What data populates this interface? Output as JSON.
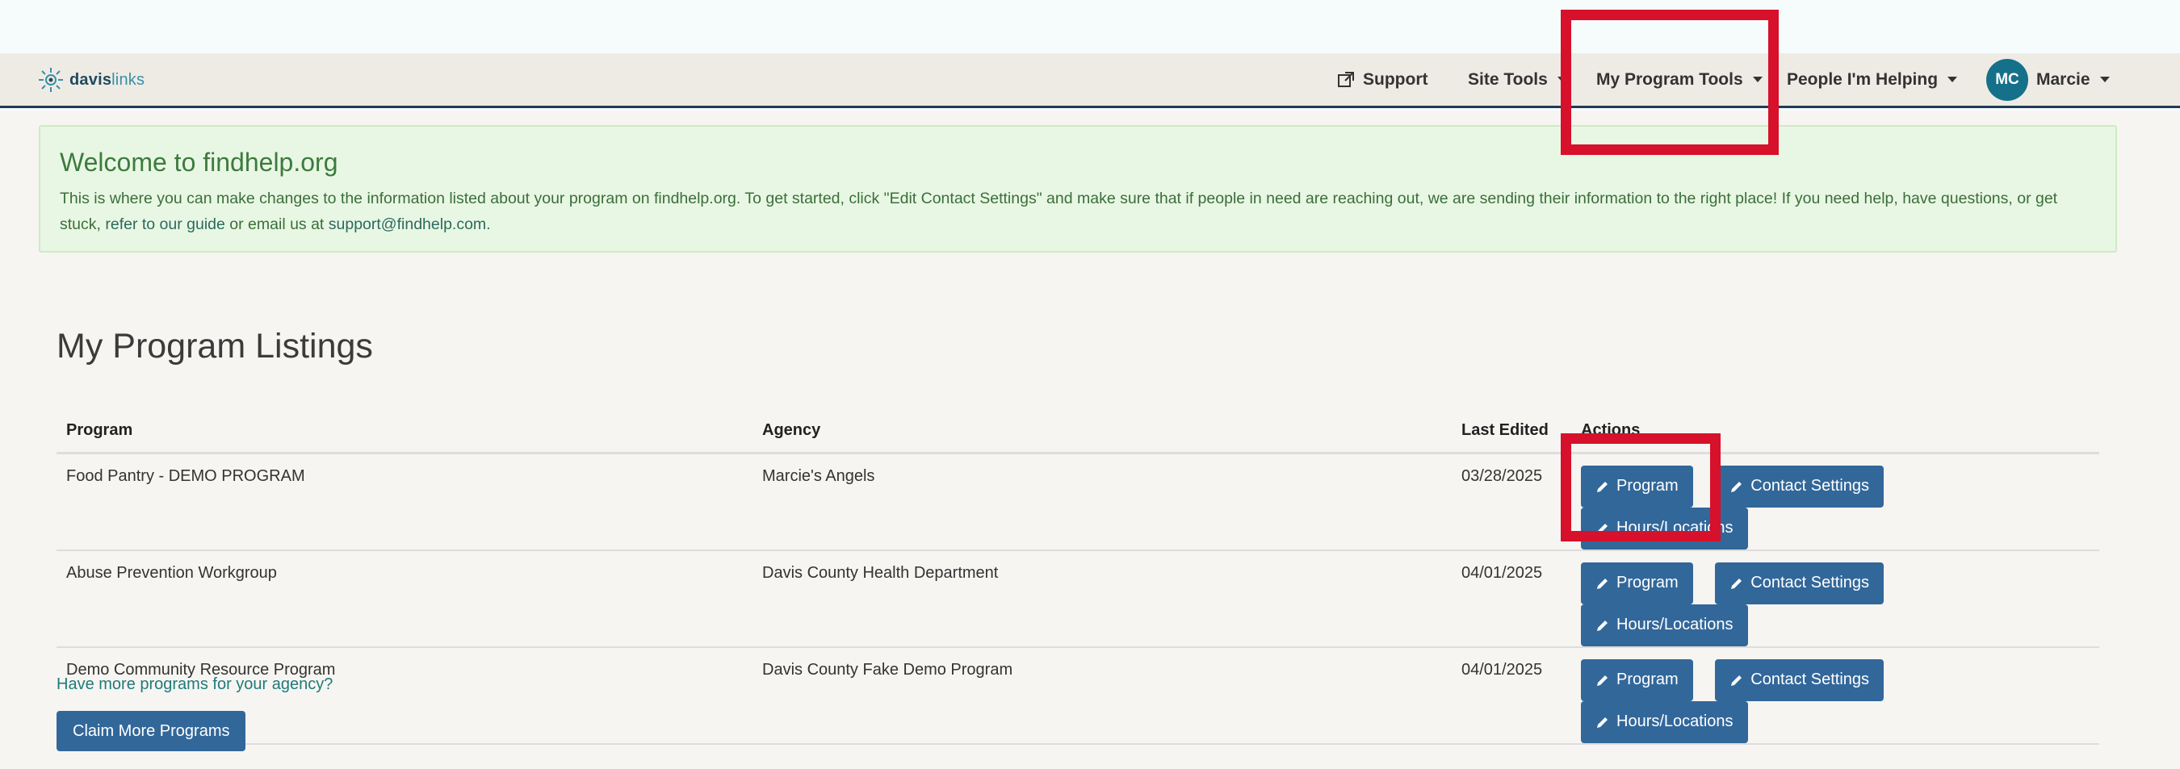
{
  "header": {
    "brand": {
      "bold": "davis",
      "light": "links"
    },
    "nav": {
      "support": "Support",
      "site_tools": "Site Tools",
      "my_program_tools": "My Program Tools",
      "people_helping": "People I'm Helping",
      "user_initials": "MC",
      "user_name": "Marcie"
    }
  },
  "alert": {
    "title": "Welcome to findhelp.org",
    "text_1": "This is where you can make changes to the information listed about your program on findhelp.org. To get started, click \"Edit Contact Settings\" and make sure that if people in need are reaching out, we are sending their information to the right place! If you need help, have questions, or get stuck, ",
    "guide_link": "refer to our guide",
    "text_2": " or email us at ",
    "email_link": "support@findhelp.com",
    "text_3": "."
  },
  "listings": {
    "title": "My Program Listings",
    "columns": {
      "program": "Program",
      "agency": "Agency",
      "last_edited": "Last Edited",
      "actions": "Actions"
    },
    "action_labels": {
      "program": "Program",
      "contact": "Contact Settings",
      "hours": "Hours/Locations"
    },
    "rows": [
      {
        "program": "Food Pantry - DEMO PROGRAM",
        "agency": "Marcie's Angels",
        "last_edited": "03/28/2025"
      },
      {
        "program": "Abuse Prevention Workgroup",
        "agency": "Davis County Health Department",
        "last_edited": "04/01/2025"
      },
      {
        "program": "Demo Community Resource Program",
        "agency": "Davis County Fake Demo Program",
        "last_edited": "04/01/2025"
      }
    ]
  },
  "footer": {
    "more_programs": "Have more programs for your agency?",
    "claim_button": "Claim More Programs"
  },
  "colors": {
    "nav_bg": "#eeebe5",
    "primary_button": "#32679a",
    "alert_bg": "#e8f7e3",
    "avatar": "#15718a",
    "highlight": "#d7102b"
  }
}
